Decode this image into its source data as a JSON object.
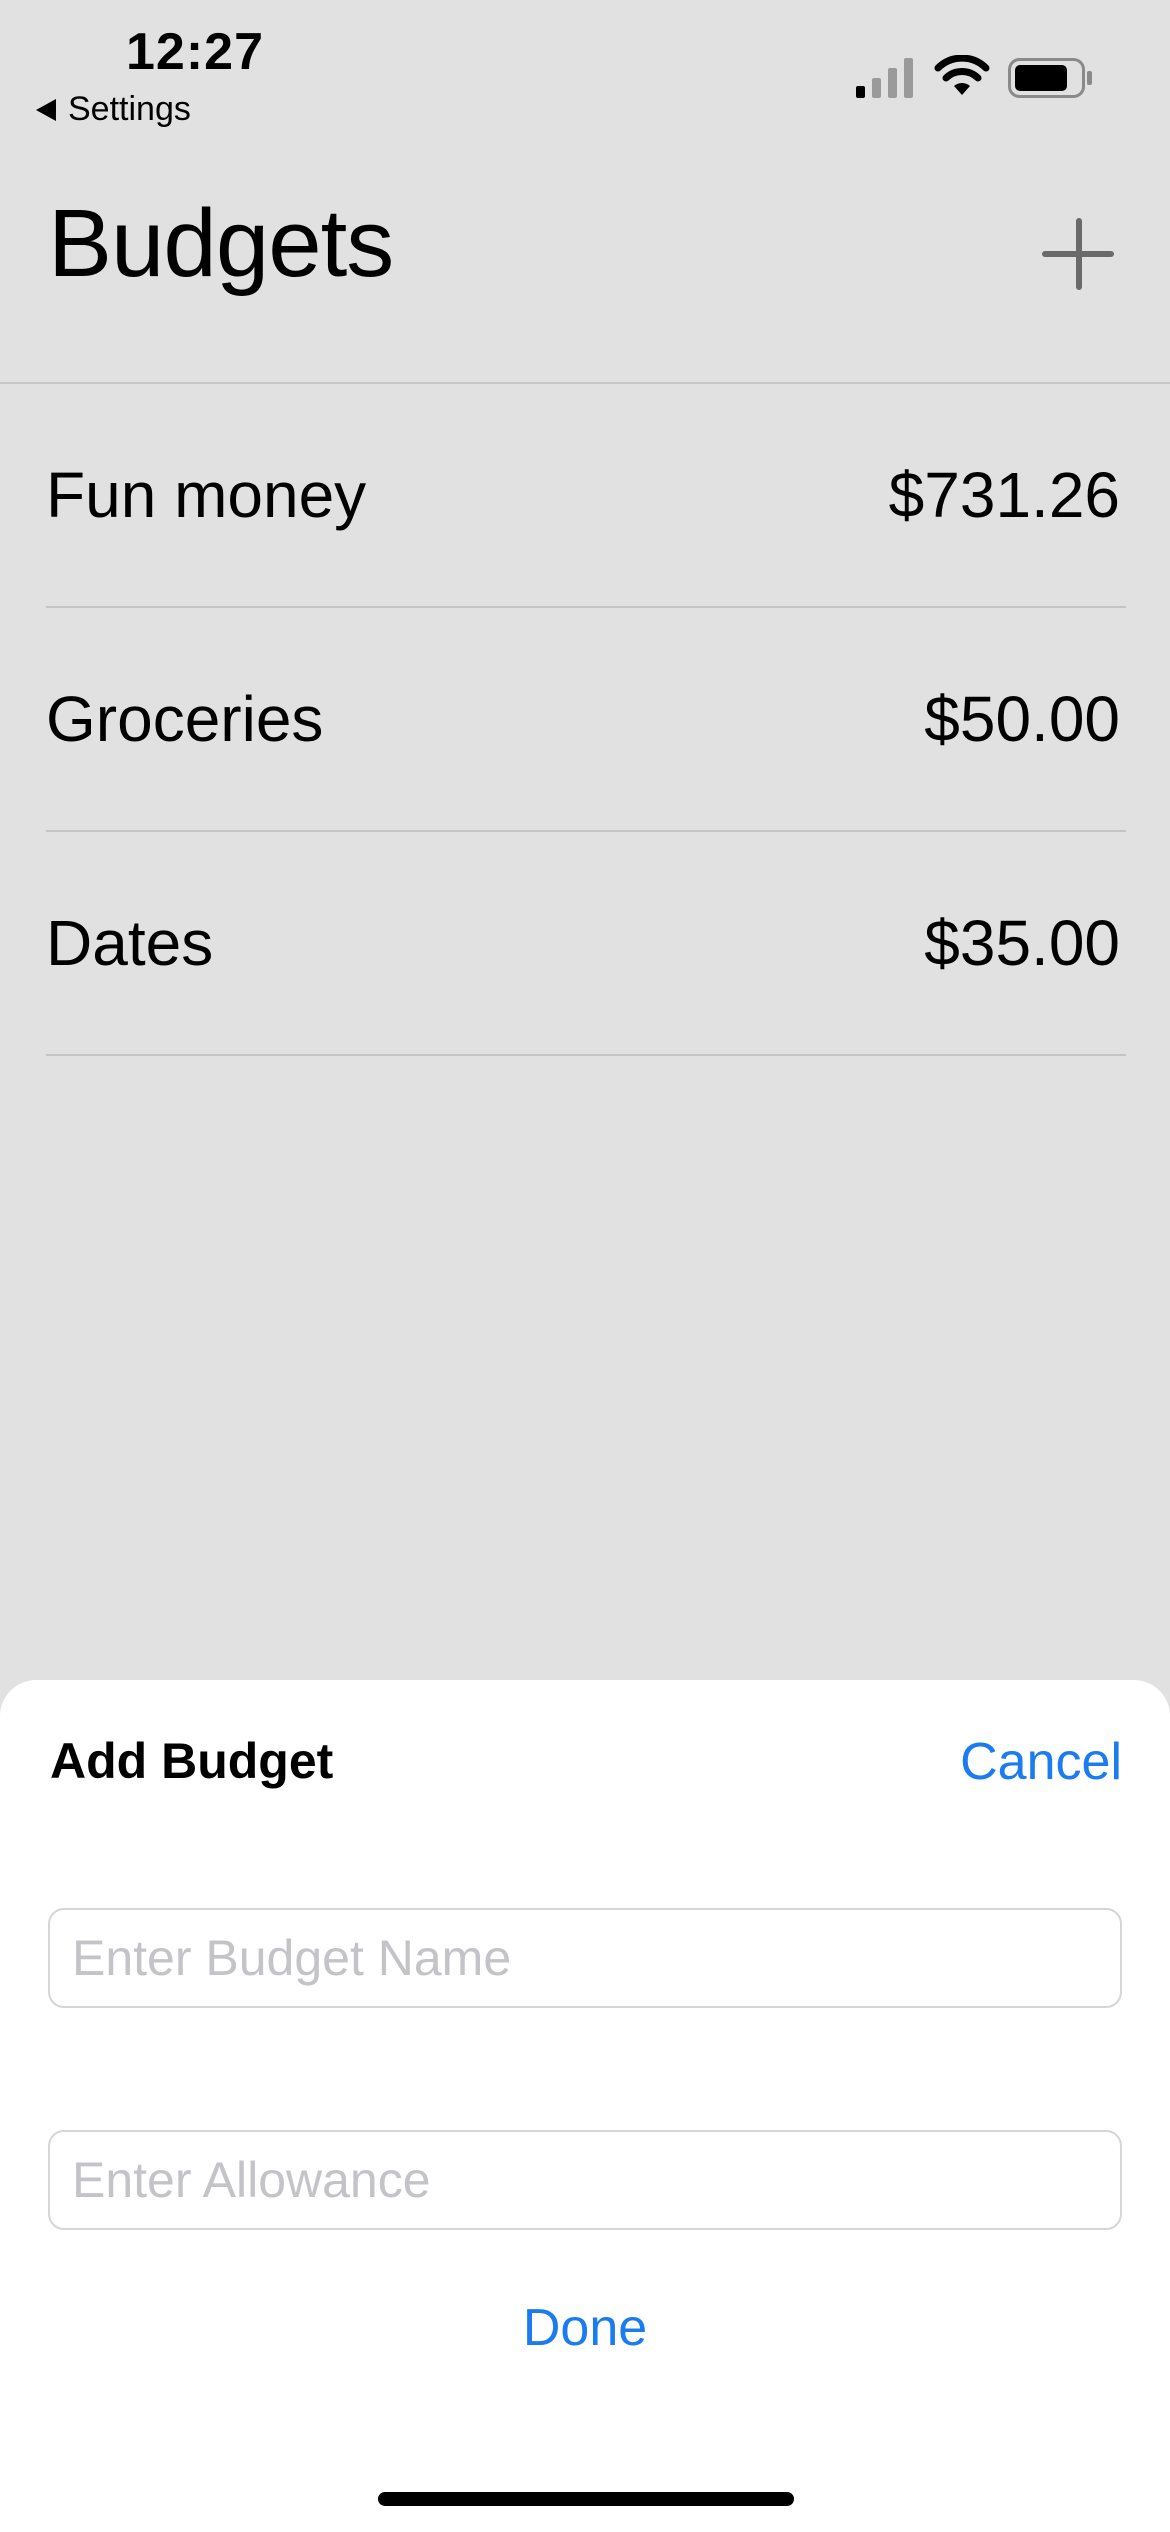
{
  "status_bar": {
    "time": "12:27",
    "back_label": "Settings",
    "icons": [
      "cellular-signal-icon",
      "wifi-icon",
      "battery-icon"
    ]
  },
  "header": {
    "title": "Budgets",
    "add_icon": "plus-icon"
  },
  "budgets": [
    {
      "name": "Fun money",
      "amount": "$731.26"
    },
    {
      "name": "Groceries",
      "amount": "$50.00"
    },
    {
      "name": "Dates",
      "amount": "$35.00"
    }
  ],
  "sheet": {
    "title": "Add Budget",
    "cancel_label": "Cancel",
    "name_field": {
      "value": "",
      "placeholder": "Enter Budget Name"
    },
    "allowance_field": {
      "value": "",
      "placeholder": "Enter Allowance"
    },
    "done_label": "Done"
  },
  "colors": {
    "background": "#e1e1e1",
    "sheet_background": "#ffffff",
    "accent": "#1a7cf0",
    "divider": "#c4c4c4",
    "placeholder": "#c4c4c8"
  }
}
